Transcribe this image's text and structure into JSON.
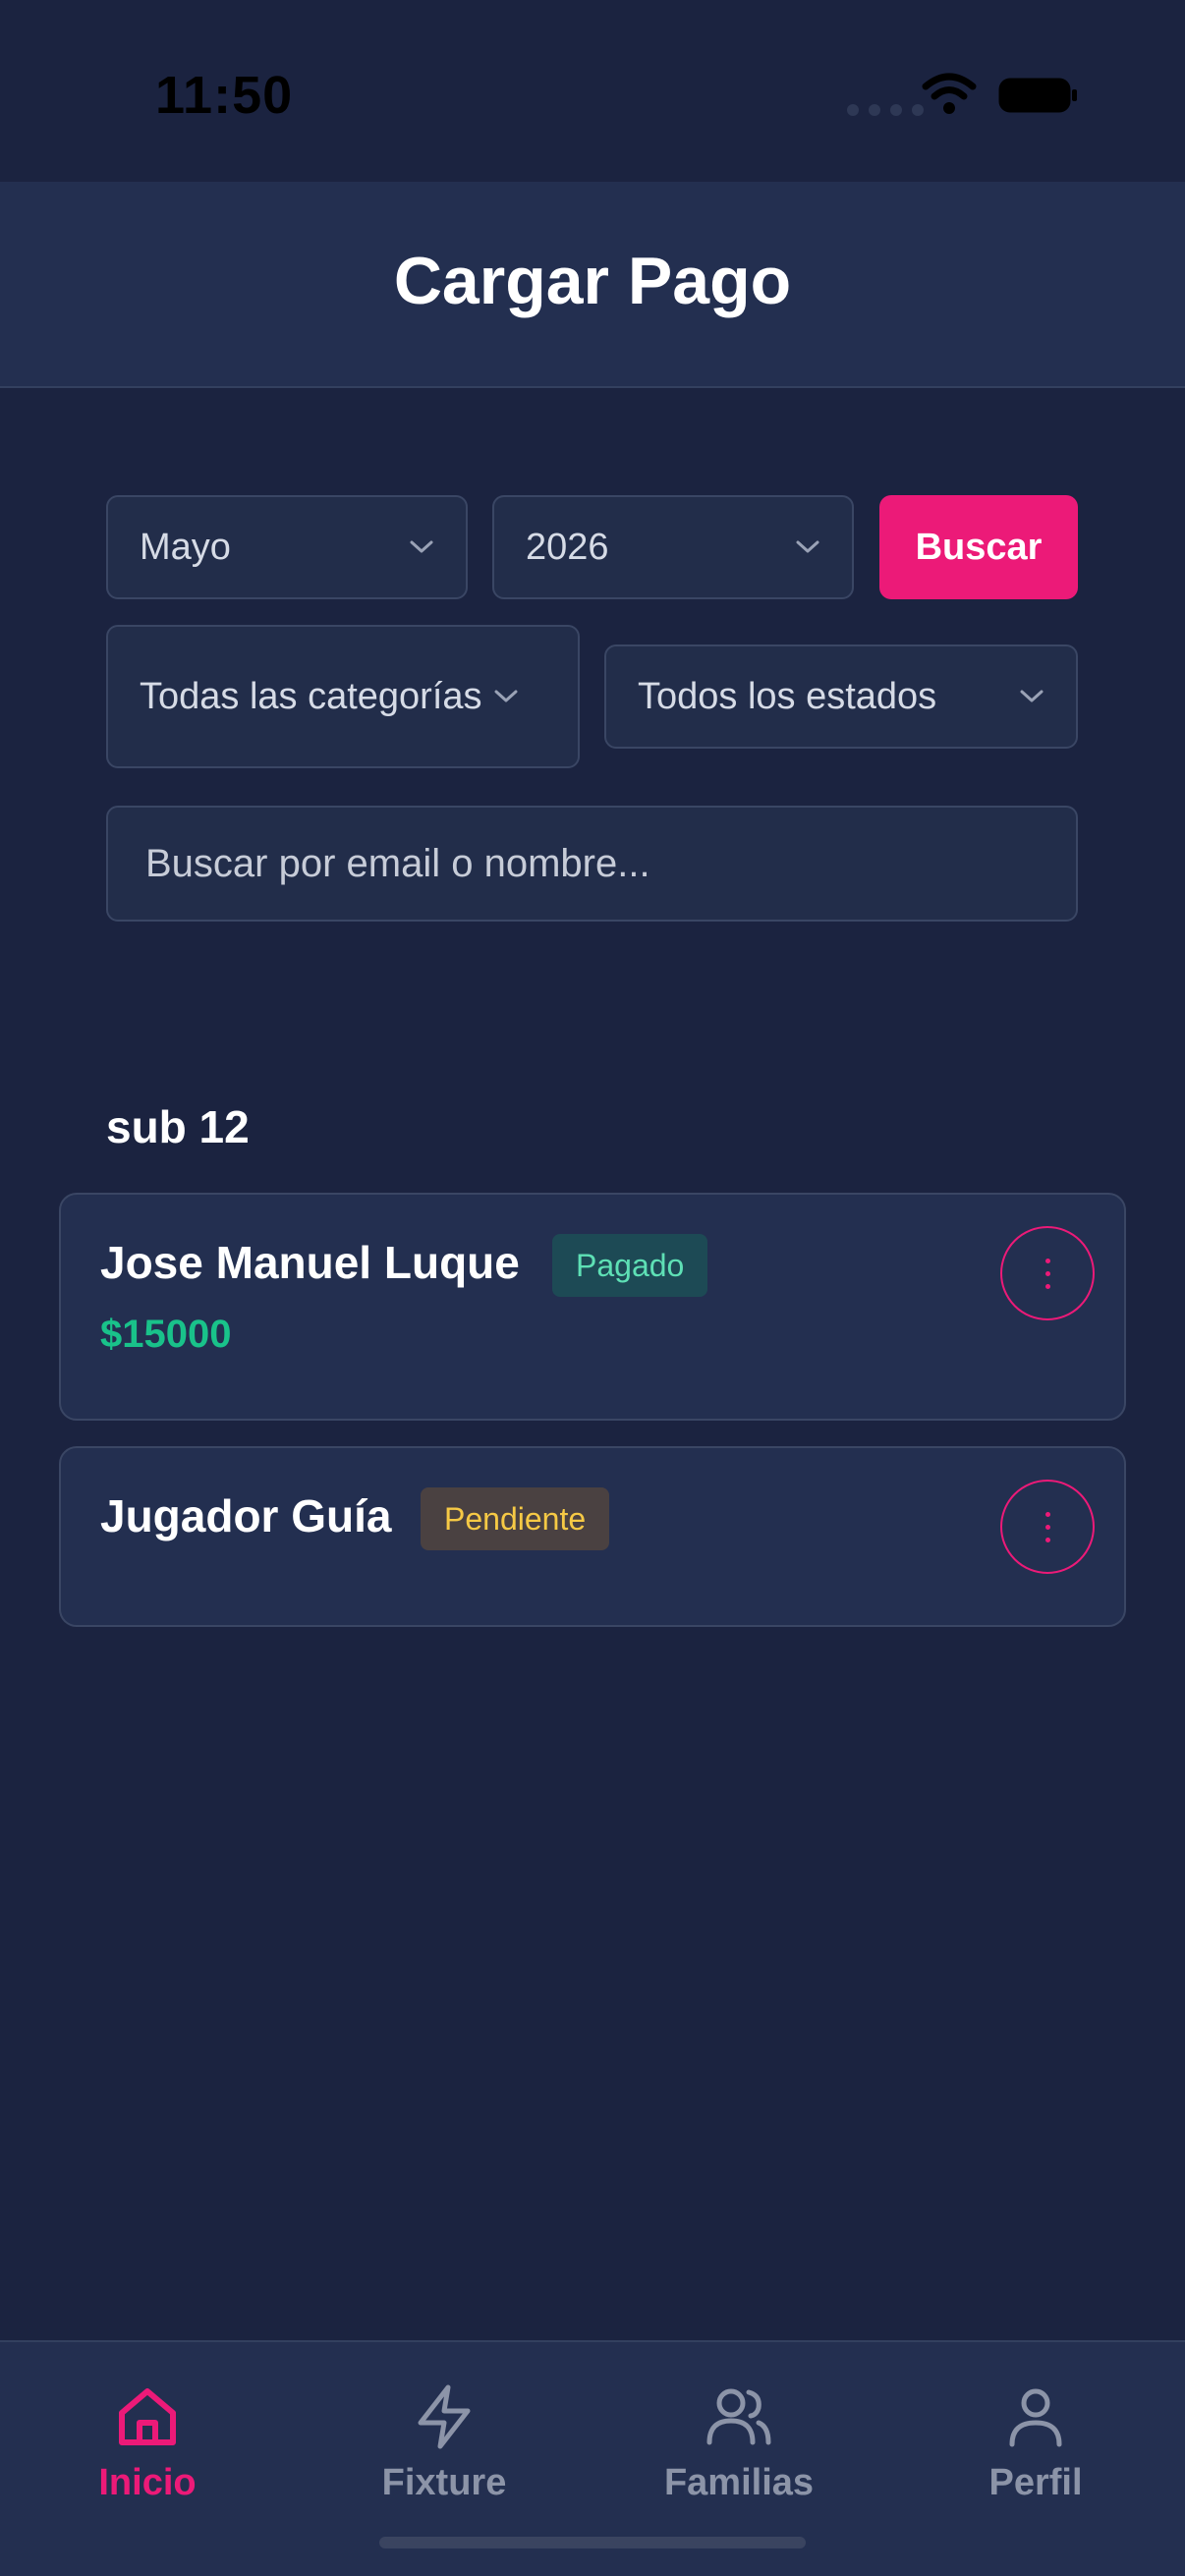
{
  "status_bar": {
    "time": "11:50"
  },
  "header": {
    "title": "Cargar Pago"
  },
  "filters": {
    "month": "Mayo",
    "year": "2026",
    "search_button": "Buscar",
    "category": "Todas las categorías",
    "status": "Todos los estados",
    "search_placeholder": "Buscar por email o nombre..."
  },
  "section": {
    "title": "sub 12"
  },
  "players": [
    {
      "name": "Jose Manuel Luque",
      "badge": "Pagado",
      "amount": "$15000"
    },
    {
      "name": "Jugador Guía",
      "badge": "Pendiente"
    }
  ],
  "tabs": [
    {
      "label": "Inicio",
      "icon": "home-icon"
    },
    {
      "label": "Fixture",
      "icon": "bolt-icon"
    },
    {
      "label": "Familias",
      "icon": "users-icon"
    },
    {
      "label": "Perfil",
      "icon": "user-icon"
    }
  ],
  "colors": {
    "accent": "#ec1a78",
    "background": "#1b2340",
    "surface": "#232f50",
    "paid": "#5ee0b5",
    "pending": "#f6c945",
    "amount": "#19c28a"
  }
}
